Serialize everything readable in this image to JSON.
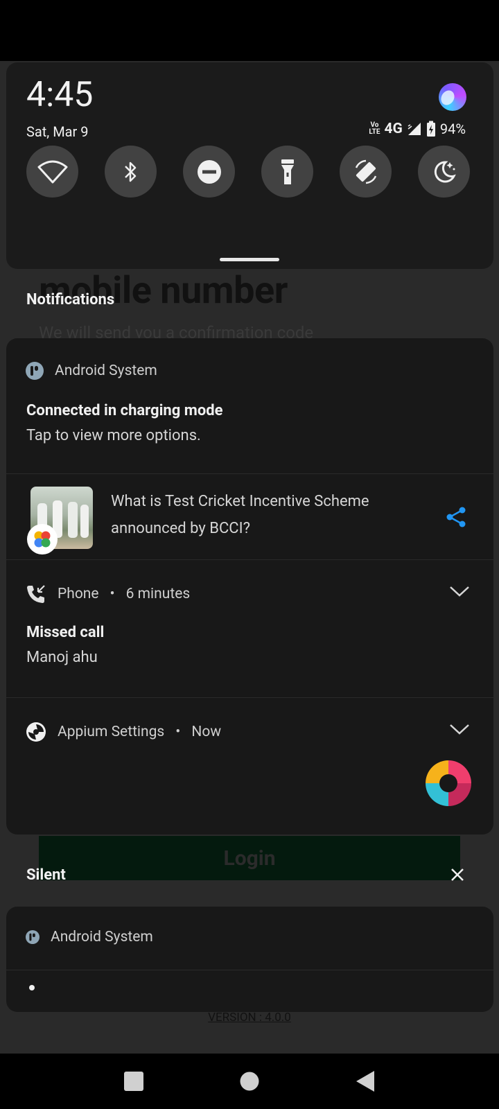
{
  "background_app": {
    "heading": "mobile number",
    "subtext": "We will send you a confirmation code",
    "login_label": "Login",
    "version": "VERSION : 4.0.0"
  },
  "quick_settings": {
    "time": "4:45",
    "date": "Sat, Mar 9",
    "status": {
      "volte": "Vo LTE",
      "network": "4G",
      "battery": "94%"
    },
    "tiles": [
      "wifi-icon",
      "bluetooth-icon",
      "do-not-disturb-icon",
      "flashlight-icon",
      "auto-rotate-icon",
      "night-light-icon"
    ]
  },
  "notifications_header": "Notifications",
  "notifications": {
    "android_system": {
      "app": "Android System",
      "title": "Connected in charging mode",
      "text": "Tap to view more options."
    },
    "news": {
      "text": "What is Test Cricket Incentive Scheme announced by BCCI?",
      "line1": "What is Test Cricket Incentive Scheme",
      "line2": "announced by BCCI?"
    },
    "phone": {
      "app": "Phone",
      "time": "6 minutes",
      "title": "Missed call",
      "text": "Manoj ahu"
    },
    "appium": {
      "app": "Appium Settings",
      "time": "Now"
    }
  },
  "silent_header": "Silent",
  "silent": {
    "app": "Android System"
  },
  "colors": {
    "accent": "#2196f3",
    "panel": "#1b1b1b",
    "card": "#181818"
  }
}
